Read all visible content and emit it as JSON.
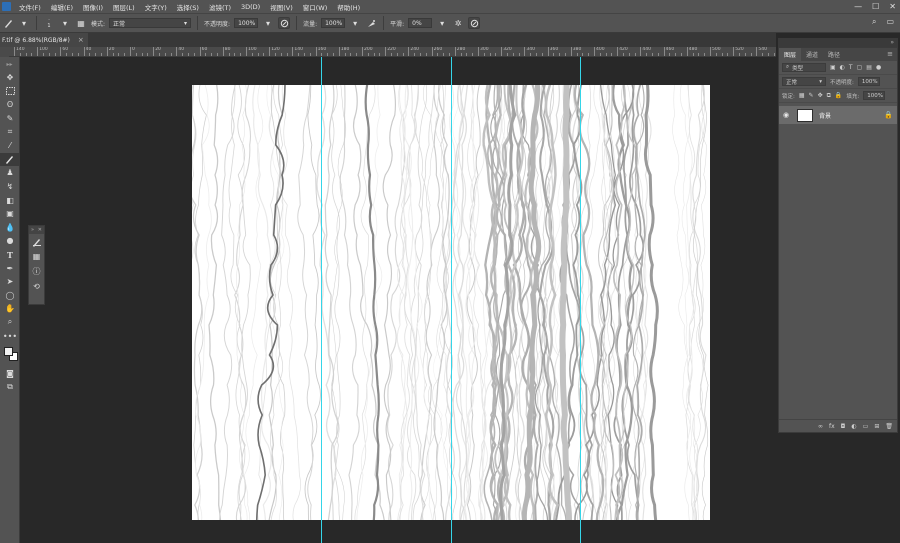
{
  "menubar": {
    "items": [
      "文件(F)",
      "编辑(E)",
      "图像(I)",
      "图层(L)",
      "文字(Y)",
      "选择(S)",
      "滤镜(T)",
      "3D(D)",
      "视图(V)",
      "窗口(W)",
      "帮助(H)"
    ],
    "window_controls": [
      "—",
      "☐",
      "✕"
    ]
  },
  "options": {
    "mode_label": "模式:",
    "mode_value": "正常",
    "opacity_label": "不透明度:",
    "opacity_value": "100%",
    "flow_label": "流量:",
    "flow_value": "100%",
    "smooth_label": "平滑:",
    "smooth_value": "0%",
    "brush_size": "1"
  },
  "document": {
    "tab_title": "F.tif @ 6.88%(RGB/8#)",
    "close": "×"
  },
  "ruler": {
    "labels": [
      "140",
      "100",
      "60",
      "40",
      "20",
      "0",
      "20",
      "40",
      "60",
      "80",
      "100",
      "120",
      "140",
      "160",
      "180",
      "200",
      "220",
      "240",
      "260",
      "280",
      "300",
      "320",
      "340",
      "360",
      "380",
      "400",
      "420",
      "440",
      "460",
      "480",
      "500",
      "520",
      "540"
    ]
  },
  "tools": [
    "move",
    "marquee",
    "lasso",
    "quick-select",
    "crop",
    "eyedropper",
    "brush",
    "clone-stamp",
    "history-brush",
    "eraser",
    "gradient",
    "blur",
    "dodge",
    "type",
    "pen",
    "path-select",
    "shape",
    "hand",
    "zoom",
    "more"
  ],
  "colors": {
    "foreground": "#f2f2f2",
    "background": "#ffffff",
    "guide": "#35d5e8",
    "canvas": "#ffffff"
  },
  "layers_panel": {
    "tabs": [
      "图层",
      "通道",
      "路径"
    ],
    "filter_label": "类型",
    "blend_mode": "正常",
    "opacity_label": "不透明度:",
    "opacity_value": "100%",
    "lock_label": "锁定:",
    "fill_label": "填充:",
    "fill_value": "100%",
    "layers": [
      {
        "name": "背景",
        "visible": true,
        "locked": true
      }
    ],
    "footer_icons": [
      "link-icon",
      "fx-icon",
      "mask-icon",
      "adjustment-icon",
      "group-icon",
      "new-layer-icon",
      "trash-icon"
    ],
    "footer_fx": "fx"
  }
}
